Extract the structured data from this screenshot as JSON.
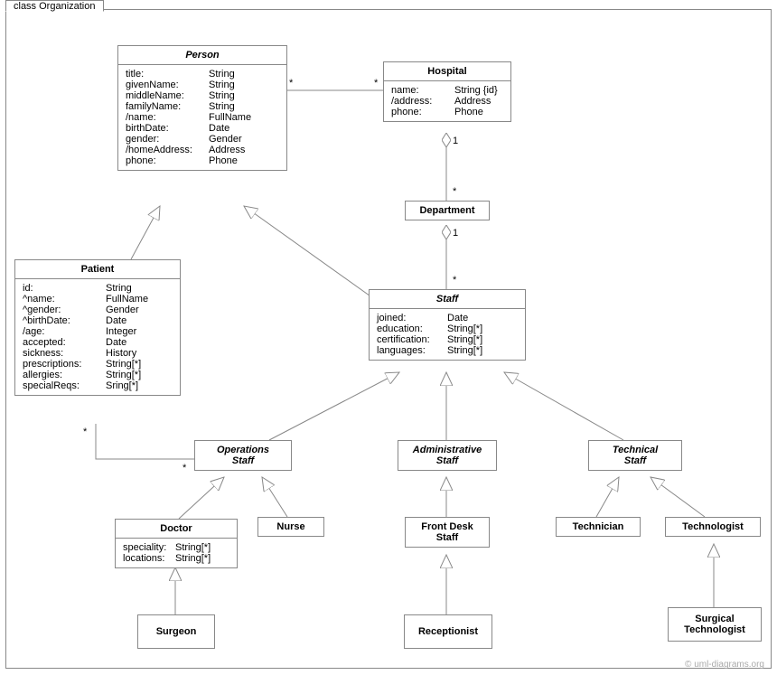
{
  "frame": {
    "title": "class Organization"
  },
  "watermark": "© uml-diagrams.org",
  "classes": {
    "person": {
      "name": "Person",
      "attrs": [
        {
          "n": "title:",
          "t": "String"
        },
        {
          "n": "givenName:",
          "t": "String"
        },
        {
          "n": "middleName:",
          "t": "String"
        },
        {
          "n": "familyName:",
          "t": "String"
        },
        {
          "n": "/name:",
          "t": "FullName"
        },
        {
          "n": "birthDate:",
          "t": "Date"
        },
        {
          "n": "gender:",
          "t": "Gender"
        },
        {
          "n": "/homeAddress:",
          "t": "Address"
        },
        {
          "n": "phone:",
          "t": "Phone"
        }
      ]
    },
    "hospital": {
      "name": "Hospital",
      "attrs": [
        {
          "n": "name:",
          "t": "String {id}"
        },
        {
          "n": "/address:",
          "t": "Address"
        },
        {
          "n": "phone:",
          "t": "Phone"
        }
      ]
    },
    "department": {
      "name": "Department"
    },
    "patient": {
      "name": "Patient",
      "attrs": [
        {
          "n": "id:",
          "t": "String"
        },
        {
          "n": "^name:",
          "t": "FullName"
        },
        {
          "n": "^gender:",
          "t": "Gender"
        },
        {
          "n": "^birthDate:",
          "t": "Date"
        },
        {
          "n": "/age:",
          "t": "Integer"
        },
        {
          "n": "accepted:",
          "t": "Date"
        },
        {
          "n": "sickness:",
          "t": "History"
        },
        {
          "n": "prescriptions:",
          "t": "String[*]"
        },
        {
          "n": "allergies:",
          "t": "String[*]"
        },
        {
          "n": "specialReqs:",
          "t": "Sring[*]"
        }
      ]
    },
    "staff": {
      "name": "Staff",
      "attrs": [
        {
          "n": "joined:",
          "t": "Date"
        },
        {
          "n": "education:",
          "t": "String[*]"
        },
        {
          "n": "certification:",
          "t": "String[*]"
        },
        {
          "n": "languages:",
          "t": "String[*]"
        }
      ]
    },
    "opsStaff": {
      "name": "Operations",
      "name2": "Staff"
    },
    "adminStaff": {
      "name": "Administrative",
      "name2": "Staff"
    },
    "techStaff": {
      "name": "Technical",
      "name2": "Staff"
    },
    "doctor": {
      "name": "Doctor",
      "attrs": [
        {
          "n": "speciality:",
          "t": "String[*]"
        },
        {
          "n": "locations:",
          "t": "String[*]"
        }
      ]
    },
    "nurse": {
      "name": "Nurse"
    },
    "frontDesk": {
      "name": "Front Desk",
      "name2": "Staff"
    },
    "technician": {
      "name": "Technician"
    },
    "technologist": {
      "name": "Technologist"
    },
    "surgeon": {
      "name": "Surgeon"
    },
    "receptionist": {
      "name": "Receptionist"
    },
    "surgTech": {
      "name": "Surgical",
      "name2": "Technologist"
    }
  },
  "mult": {
    "personHospL": "*",
    "personHospR": "*",
    "hospDeptTop": "1",
    "hospDeptBot": "*",
    "deptStaffTop": "1",
    "deptStaffBot": "*",
    "patientOpsL": "*",
    "patientOpsR": "*"
  }
}
